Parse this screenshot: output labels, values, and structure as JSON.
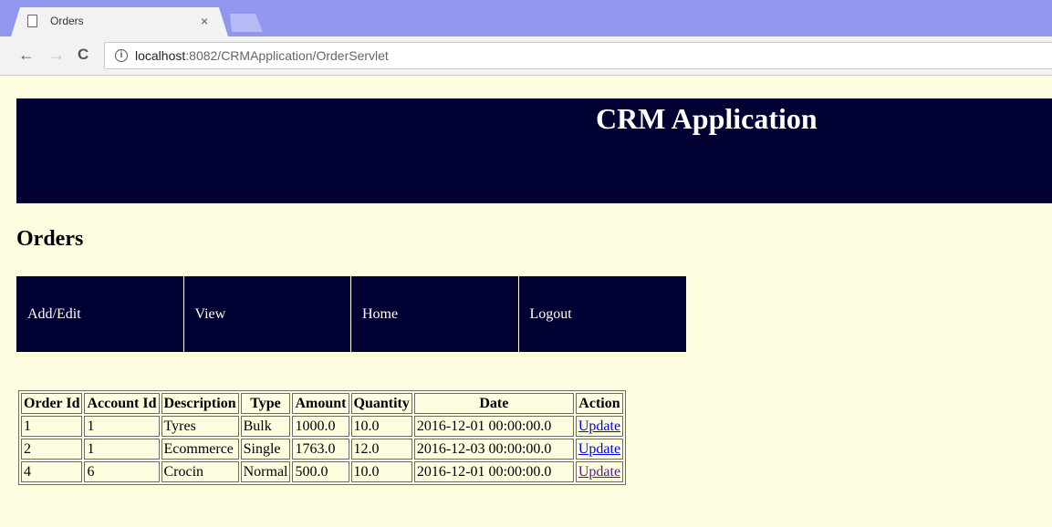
{
  "browser": {
    "tab_title": "Orders",
    "tab_close": "×",
    "url_host": "localhost",
    "url_path": ":8082/CRMApplication/OrderServlet",
    "nav": {
      "back": "←",
      "forward": "→",
      "reload": "C"
    },
    "info_icon": "i"
  },
  "header": {
    "title": "CRM Application"
  },
  "page": {
    "heading": "Orders"
  },
  "menu": {
    "items": [
      {
        "label": "Add/Edit"
      },
      {
        "label": "View"
      },
      {
        "label": "Home"
      },
      {
        "label": "Logout"
      }
    ]
  },
  "table": {
    "headers": [
      "Order Id",
      "Account Id",
      "Description",
      "Type",
      "Amount",
      "Quantity",
      "Date",
      "Action"
    ],
    "rows": [
      {
        "order_id": "1",
        "account_id": "1",
        "description": "Tyres",
        "type": "Bulk",
        "amount": "1000.0",
        "quantity": "10.0",
        "date": "2016-12-01 00:00:00.0",
        "action": "Update"
      },
      {
        "order_id": "2",
        "account_id": "1",
        "description": "Ecommerce",
        "type": "Single",
        "amount": "1763.0",
        "quantity": "12.0",
        "date": "2016-12-03 00:00:00.0",
        "action": "Update"
      },
      {
        "order_id": "4",
        "account_id": "6",
        "description": "Crocin",
        "type": "Normal",
        "amount": "500.0",
        "quantity": "10.0",
        "date": "2016-12-01 00:00:00.0",
        "action": "Update"
      }
    ]
  },
  "colors": {
    "header_bg": "#010032",
    "page_bg": "#fffde0",
    "link": "#0000ee",
    "visited_link": "#551a8b"
  }
}
